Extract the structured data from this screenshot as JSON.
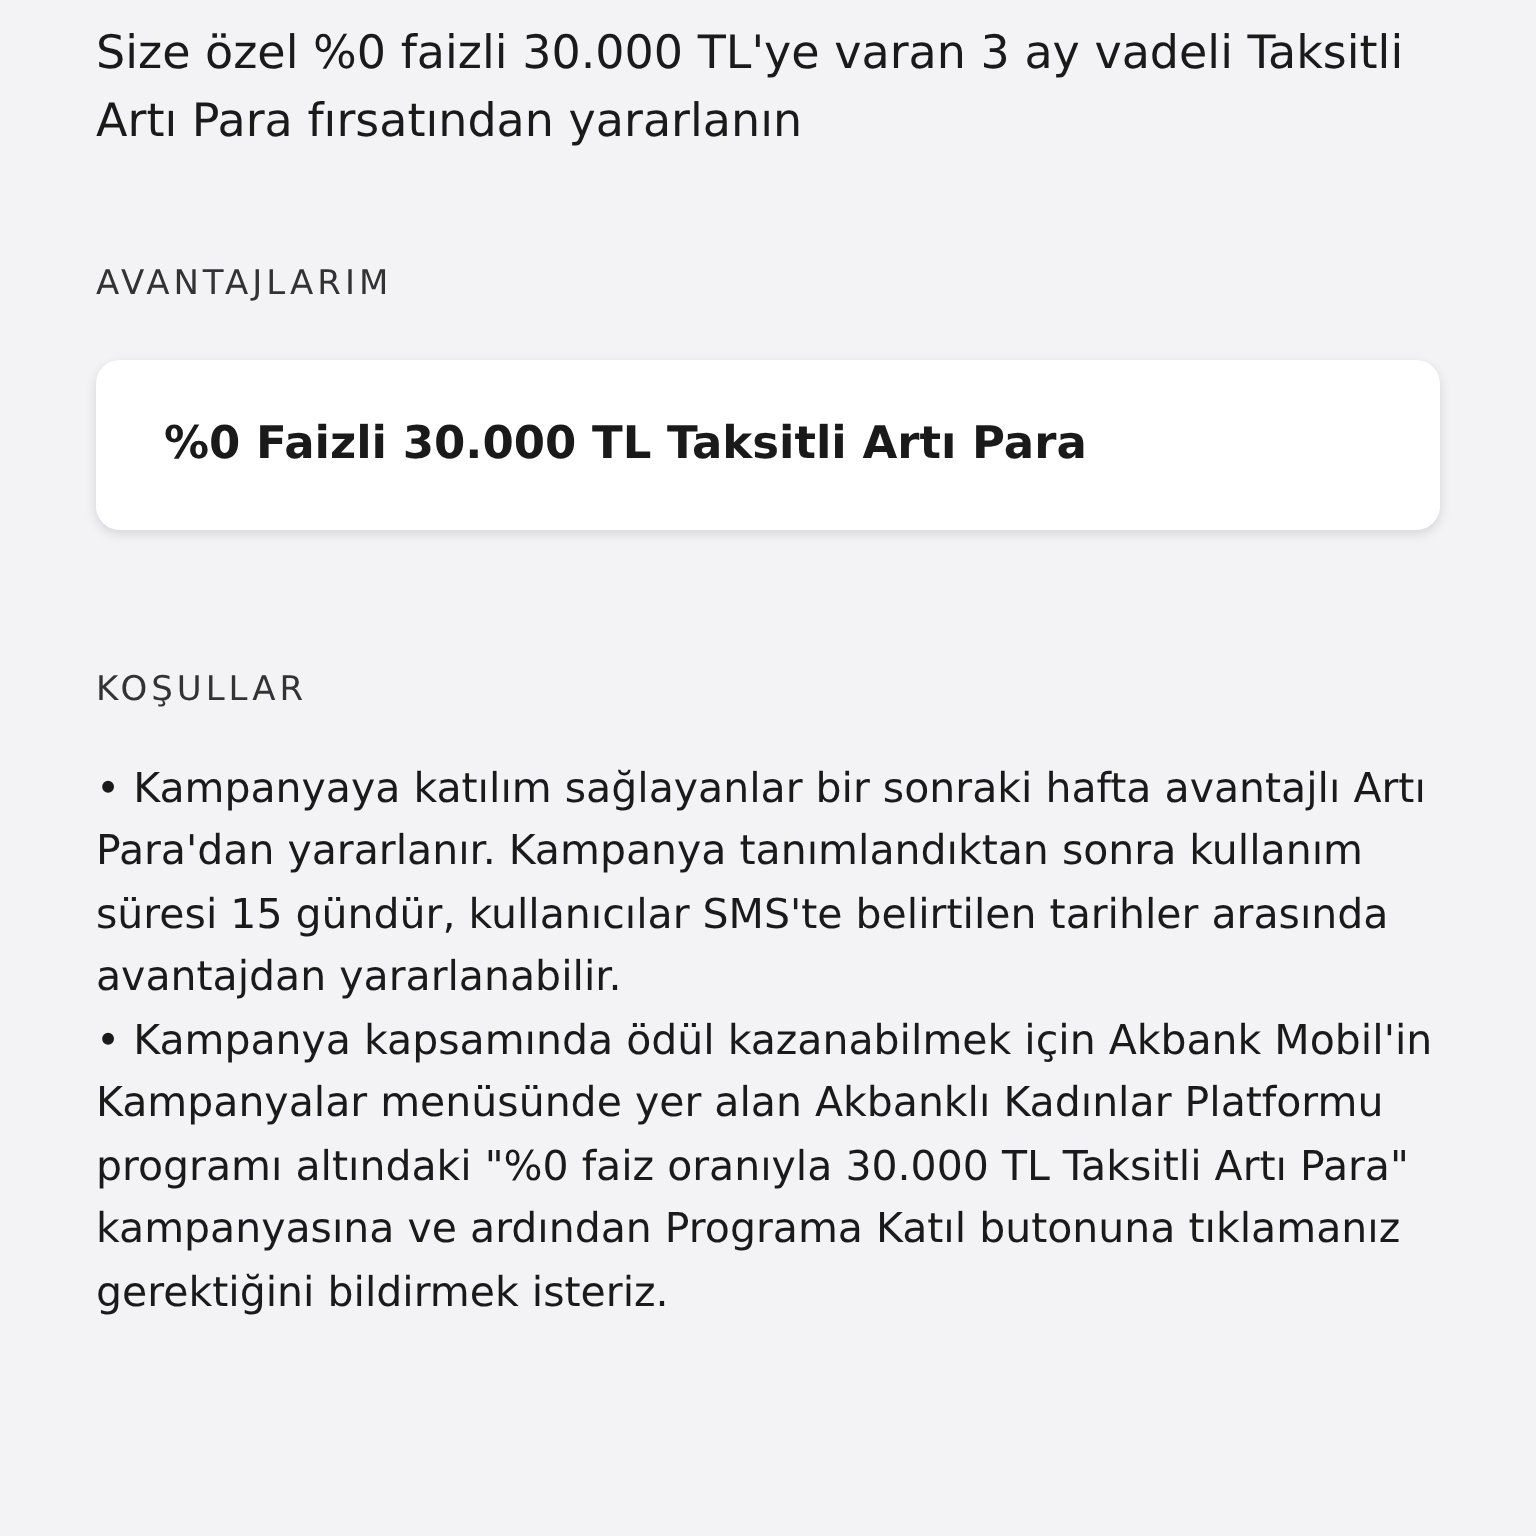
{
  "headline": "Size özel %0 faizli 30.000 TL'ye varan 3 ay vadeli Taksitli Artı Para fırsatından yararlanın",
  "advantages": {
    "title": "AVANTAJLARIM",
    "items": [
      {
        "text": "%0 Faizli 30.000 TL Taksitli Artı Para"
      }
    ]
  },
  "conditions": {
    "title": "KOŞULLAR",
    "items": [
      "• Kampanyaya katılım sağlayanlar bir sonraki hafta avantajlı Artı Para'dan yararlanır. Kampanya tanımlandıktan sonra kullanım süresi 15 gündür, kullanıcılar SMS'te belirtilen tarihler arasında avantajdan yararlanabilir.",
      "• Kampanya kapsamında ödül kazanabilmek için Akbank Mobil'in Kampanyalar menüsünde yer alan Akbanklı Kadınlar Platformu programı altındaki \"%0 faiz oranıyla 30.000 TL Taksitli Artı Para\" kampanyasına ve ardından Programa Katıl butonuna tıklamanız gerektiğini bildirmek isteriz."
    ]
  }
}
